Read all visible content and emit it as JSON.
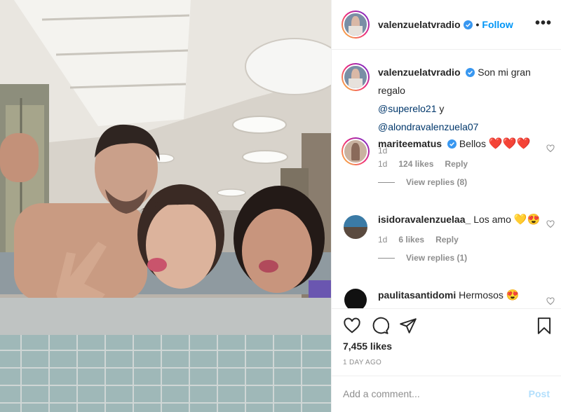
{
  "post": {
    "username": "valenzuelatvradio",
    "separator": "•",
    "follow_label": "Follow",
    "more_label": "•••"
  },
  "caption": {
    "username": "valenzuelatvradio",
    "text": "Son mi gran regalo",
    "mention1": "@superelo21",
    "connector": "y",
    "mention2": "@alondravalenzuela07",
    "time": "1d"
  },
  "comments": [
    {
      "username": "mariteematus",
      "text": "Bellos",
      "emoji": "❤️❤️❤️",
      "time": "1d",
      "likes": "124 likes",
      "reply": "Reply",
      "view_replies": "View replies (8)"
    },
    {
      "username": "isidoravalenzuelaa_",
      "text": "Los amo",
      "emoji": "💛😍",
      "time": "1d",
      "likes": "6 likes",
      "reply": "Reply",
      "view_replies": "View replies (1)"
    },
    {
      "username": "paulitasantidomi",
      "text": "Hermosos",
      "emoji": "😍"
    }
  ],
  "footer": {
    "likes": "7,455 likes",
    "posted": "1 DAY AGO",
    "comment_placeholder": "Add a comment...",
    "post_label": "Post"
  },
  "colors": {
    "link_blue": "#0095f6",
    "mention": "#00376b",
    "muted": "#8e8e8e",
    "post_disabled": "#b2dffc",
    "verified": "#3897f0"
  },
  "icons": [
    "heart-icon",
    "comment-icon",
    "share-icon",
    "bookmark-icon",
    "verified-badge-icon",
    "more-options-icon"
  ]
}
